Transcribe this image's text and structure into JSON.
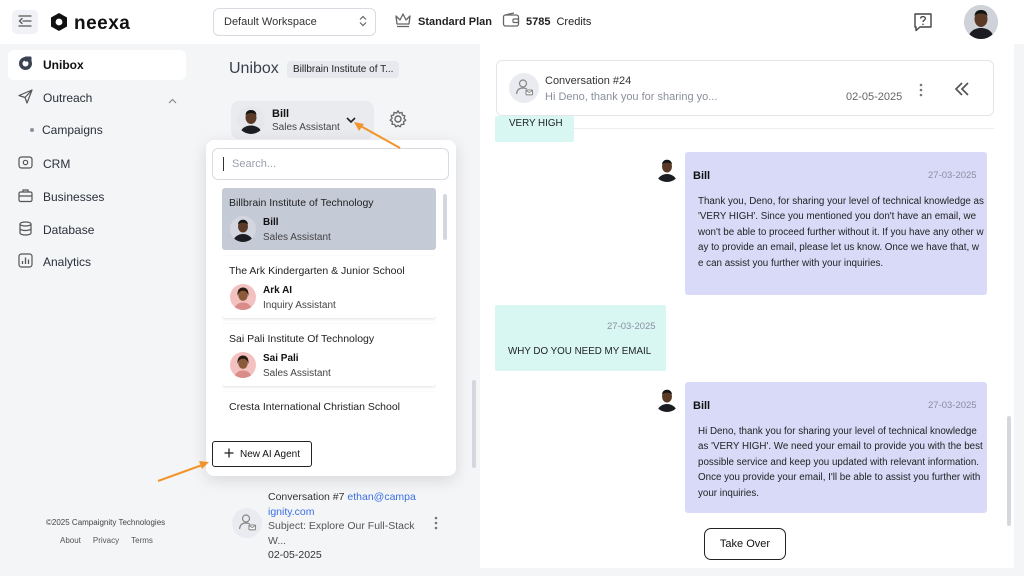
{
  "app": {
    "logo_text": "neexa"
  },
  "topbar": {
    "workspace": "Default Workspace",
    "plan": "Standard Plan",
    "credits_value": "5785",
    "credits_label": "Credits"
  },
  "nav": {
    "items": [
      {
        "label": "Unibox"
      },
      {
        "label": "Outreach"
      },
      {
        "label": "Campaigns"
      },
      {
        "label": "CRM"
      },
      {
        "label": "Businesses"
      },
      {
        "label": "Database"
      },
      {
        "label": "Analytics"
      }
    ],
    "copyright": "©2025 Campaignity Technologies",
    "links": [
      "About",
      "Privacy",
      "Terms"
    ]
  },
  "unibox": {
    "title": "Unibox",
    "org_chip": "Billbrain Institute of T...",
    "selected_agent": {
      "name": "Bill",
      "role": "Sales Assistant"
    },
    "dropdown": {
      "search_placeholder": "Search...",
      "agents": [
        {
          "org": "Billbrain Institute of Technology",
          "name": "Bill",
          "role": "Sales Assistant"
        },
        {
          "org": "The Ark Kindergarten & Junior School",
          "name": "Ark AI",
          "role": "Inquiry Assistant"
        },
        {
          "org": "Sai Pali Institute Of Technology",
          "name": "Sai Pali",
          "role": "Sales Assistant"
        },
        {
          "org": "Cresta International Christian School",
          "name": "",
          "role": ""
        }
      ],
      "new_agent_label": "New AI Agent"
    },
    "conversation_item": {
      "title": "Conversation #7",
      "email_part1": "ethan@campa",
      "email_part2": "ignity.com",
      "subject_line1": "Subject: Explore Our Full-Stack",
      "subject_line2": "W...",
      "date": "02-05-2025"
    }
  },
  "chat": {
    "header": {
      "title": "Conversation #24",
      "preview": "Hi Deno, thank you for sharing yo...",
      "date": "02-05-2025"
    },
    "messages": [
      {
        "sender": "user",
        "text": "VERY HIGH"
      },
      {
        "sender": "bot",
        "name": "Bill",
        "date": "27-03-2025",
        "text": "Thank you, Deno, for sharing your level of technical knowledge as 'VERY HIGH'. Since you mentioned you don't have an email, we won't be able to proceed further without it. If you have any other way to provide an email, please let us know. Once we have that, we can assist you further with your inquiries."
      },
      {
        "sender": "user",
        "date": "27-03-2025",
        "text": "WHY DO YOU NEED MY EMAIL"
      },
      {
        "sender": "bot",
        "name": "Bill",
        "date": "27-03-2025",
        "text": "Hi Deno, thank you for sharing your level of technical knowledge as 'VERY HIGH'. We need your email to provide you with the best possible service and keep you updated with relevant information. Once you provide your email, I'll be able to assist you further with your inquiries."
      }
    ],
    "takeover_label": "Take Over"
  },
  "colors": {
    "bot_bubble": "#d8daf8",
    "user_bubble": "#d8f7f2",
    "annotation_arrow": "#f2942c",
    "selected_agent_card": "#c5cad7"
  },
  "icons": [
    "menu-icon",
    "neexa-logo-icon",
    "updown-chevron-icon",
    "crown-icon",
    "wallet-icon",
    "help-chat-icon",
    "unibox-icon",
    "send-icon",
    "crm-icon",
    "briefcase-icon",
    "database-icon",
    "analytics-icon",
    "chevron-up-icon",
    "chevron-down-icon",
    "gear-icon",
    "plus-icon",
    "user-mail-icon",
    "kebab-icon",
    "double-chevron-left-icon"
  ]
}
